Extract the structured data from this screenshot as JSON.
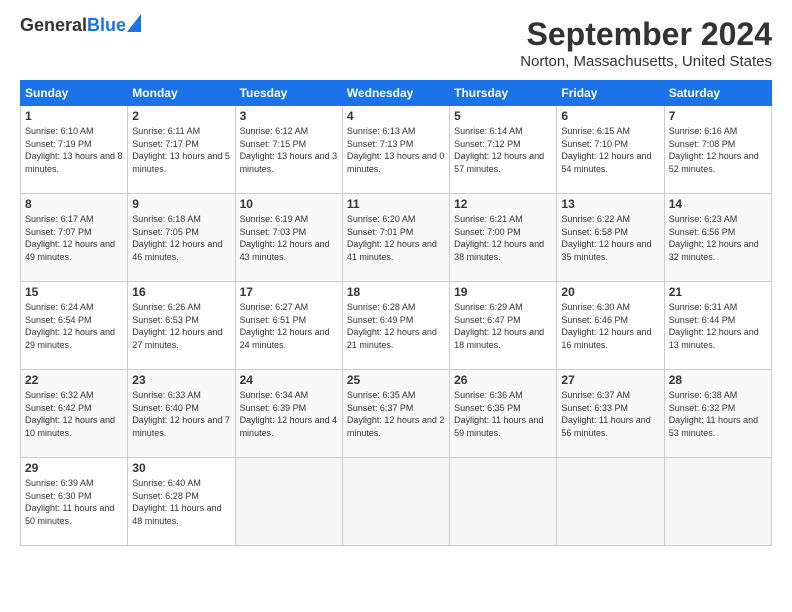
{
  "header": {
    "logo_general": "General",
    "logo_blue": "Blue",
    "month_title": "September 2024",
    "location": "Norton, Massachusetts, United States"
  },
  "days_of_week": [
    "Sunday",
    "Monday",
    "Tuesday",
    "Wednesday",
    "Thursday",
    "Friday",
    "Saturday"
  ],
  "weeks": [
    [
      {
        "num": "1",
        "sunrise": "6:10 AM",
        "sunset": "7:19 PM",
        "daylight": "13 hours and 8 minutes."
      },
      {
        "num": "2",
        "sunrise": "6:11 AM",
        "sunset": "7:17 PM",
        "daylight": "13 hours and 5 minutes."
      },
      {
        "num": "3",
        "sunrise": "6:12 AM",
        "sunset": "7:15 PM",
        "daylight": "13 hours and 3 minutes."
      },
      {
        "num": "4",
        "sunrise": "6:13 AM",
        "sunset": "7:13 PM",
        "daylight": "13 hours and 0 minutes."
      },
      {
        "num": "5",
        "sunrise": "6:14 AM",
        "sunset": "7:12 PM",
        "daylight": "12 hours and 57 minutes."
      },
      {
        "num": "6",
        "sunrise": "6:15 AM",
        "sunset": "7:10 PM",
        "daylight": "12 hours and 54 minutes."
      },
      {
        "num": "7",
        "sunrise": "6:16 AM",
        "sunset": "7:08 PM",
        "daylight": "12 hours and 52 minutes."
      }
    ],
    [
      {
        "num": "8",
        "sunrise": "6:17 AM",
        "sunset": "7:07 PM",
        "daylight": "12 hours and 49 minutes."
      },
      {
        "num": "9",
        "sunrise": "6:18 AM",
        "sunset": "7:05 PM",
        "daylight": "12 hours and 46 minutes."
      },
      {
        "num": "10",
        "sunrise": "6:19 AM",
        "sunset": "7:03 PM",
        "daylight": "12 hours and 43 minutes."
      },
      {
        "num": "11",
        "sunrise": "6:20 AM",
        "sunset": "7:01 PM",
        "daylight": "12 hours and 41 minutes."
      },
      {
        "num": "12",
        "sunrise": "6:21 AM",
        "sunset": "7:00 PM",
        "daylight": "12 hours and 38 minutes."
      },
      {
        "num": "13",
        "sunrise": "6:22 AM",
        "sunset": "6:58 PM",
        "daylight": "12 hours and 35 minutes."
      },
      {
        "num": "14",
        "sunrise": "6:23 AM",
        "sunset": "6:56 PM",
        "daylight": "12 hours and 32 minutes."
      }
    ],
    [
      {
        "num": "15",
        "sunrise": "6:24 AM",
        "sunset": "6:54 PM",
        "daylight": "12 hours and 29 minutes."
      },
      {
        "num": "16",
        "sunrise": "6:26 AM",
        "sunset": "6:53 PM",
        "daylight": "12 hours and 27 minutes."
      },
      {
        "num": "17",
        "sunrise": "6:27 AM",
        "sunset": "6:51 PM",
        "daylight": "12 hours and 24 minutes."
      },
      {
        "num": "18",
        "sunrise": "6:28 AM",
        "sunset": "6:49 PM",
        "daylight": "12 hours and 21 minutes."
      },
      {
        "num": "19",
        "sunrise": "6:29 AM",
        "sunset": "6:47 PM",
        "daylight": "12 hours and 18 minutes."
      },
      {
        "num": "20",
        "sunrise": "6:30 AM",
        "sunset": "6:46 PM",
        "daylight": "12 hours and 16 minutes."
      },
      {
        "num": "21",
        "sunrise": "6:31 AM",
        "sunset": "6:44 PM",
        "daylight": "12 hours and 13 minutes."
      }
    ],
    [
      {
        "num": "22",
        "sunrise": "6:32 AM",
        "sunset": "6:42 PM",
        "daylight": "12 hours and 10 minutes."
      },
      {
        "num": "23",
        "sunrise": "6:33 AM",
        "sunset": "6:40 PM",
        "daylight": "12 hours and 7 minutes."
      },
      {
        "num": "24",
        "sunrise": "6:34 AM",
        "sunset": "6:39 PM",
        "daylight": "12 hours and 4 minutes."
      },
      {
        "num": "25",
        "sunrise": "6:35 AM",
        "sunset": "6:37 PM",
        "daylight": "12 hours and 2 minutes."
      },
      {
        "num": "26",
        "sunrise": "6:36 AM",
        "sunset": "6:35 PM",
        "daylight": "11 hours and 59 minutes."
      },
      {
        "num": "27",
        "sunrise": "6:37 AM",
        "sunset": "6:33 PM",
        "daylight": "11 hours and 56 minutes."
      },
      {
        "num": "28",
        "sunrise": "6:38 AM",
        "sunset": "6:32 PM",
        "daylight": "11 hours and 53 minutes."
      }
    ],
    [
      {
        "num": "29",
        "sunrise": "6:39 AM",
        "sunset": "6:30 PM",
        "daylight": "11 hours and 50 minutes."
      },
      {
        "num": "30",
        "sunrise": "6:40 AM",
        "sunset": "6:28 PM",
        "daylight": "11 hours and 48 minutes."
      },
      {
        "num": "",
        "sunrise": "",
        "sunset": "",
        "daylight": ""
      },
      {
        "num": "",
        "sunrise": "",
        "sunset": "",
        "daylight": ""
      },
      {
        "num": "",
        "sunrise": "",
        "sunset": "",
        "daylight": ""
      },
      {
        "num": "",
        "sunrise": "",
        "sunset": "",
        "daylight": ""
      },
      {
        "num": "",
        "sunrise": "",
        "sunset": "",
        "daylight": ""
      }
    ]
  ],
  "labels": {
    "sunrise": "Sunrise:",
    "sunset": "Sunset:",
    "daylight": "Daylight:"
  }
}
